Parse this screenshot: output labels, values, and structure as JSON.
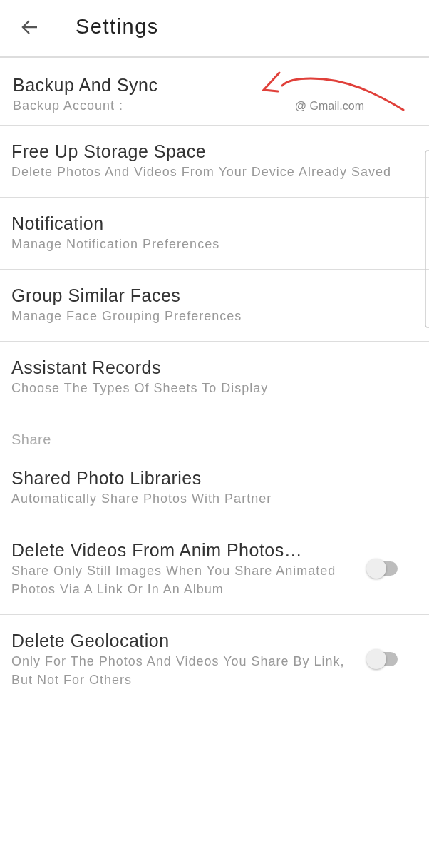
{
  "header": {
    "title": "Settings"
  },
  "items": [
    {
      "kind": "account",
      "title": "Backup And Sync",
      "subtitle": "Backup Account :",
      "account": "@ Gmail.com"
    },
    {
      "kind": "setting",
      "title": "Free Up Storage Space",
      "subtitle": "Delete Photos And Videos From Your Device Already Saved"
    },
    {
      "kind": "setting",
      "title": "Notification",
      "subtitle": "Manage Notification Preferences"
    },
    {
      "kind": "setting",
      "title": "Group Similar Faces",
      "subtitle": "Manage Face Grouping Preferences"
    },
    {
      "kind": "setting",
      "title": "Assistant Records",
      "subtitle": "Choose The Types Of Sheets To Display",
      "divider": false
    },
    {
      "kind": "section",
      "title": "Share"
    },
    {
      "kind": "setting",
      "title": "Shared Photo Libraries",
      "subtitle": "Automatically Share Photos With Partner"
    },
    {
      "kind": "toggle",
      "title": "Delete Videos From Anim Photos…",
      "subtitle": "Share Only Still Images When You Share Animated Photos Via A Link Or In An Album",
      "on": false
    },
    {
      "kind": "toggle",
      "title": "Delete Geolocation",
      "subtitle": "Only For The Photos And Videos You Share By Link, But Not For Others",
      "on": false,
      "divider": false
    }
  ]
}
